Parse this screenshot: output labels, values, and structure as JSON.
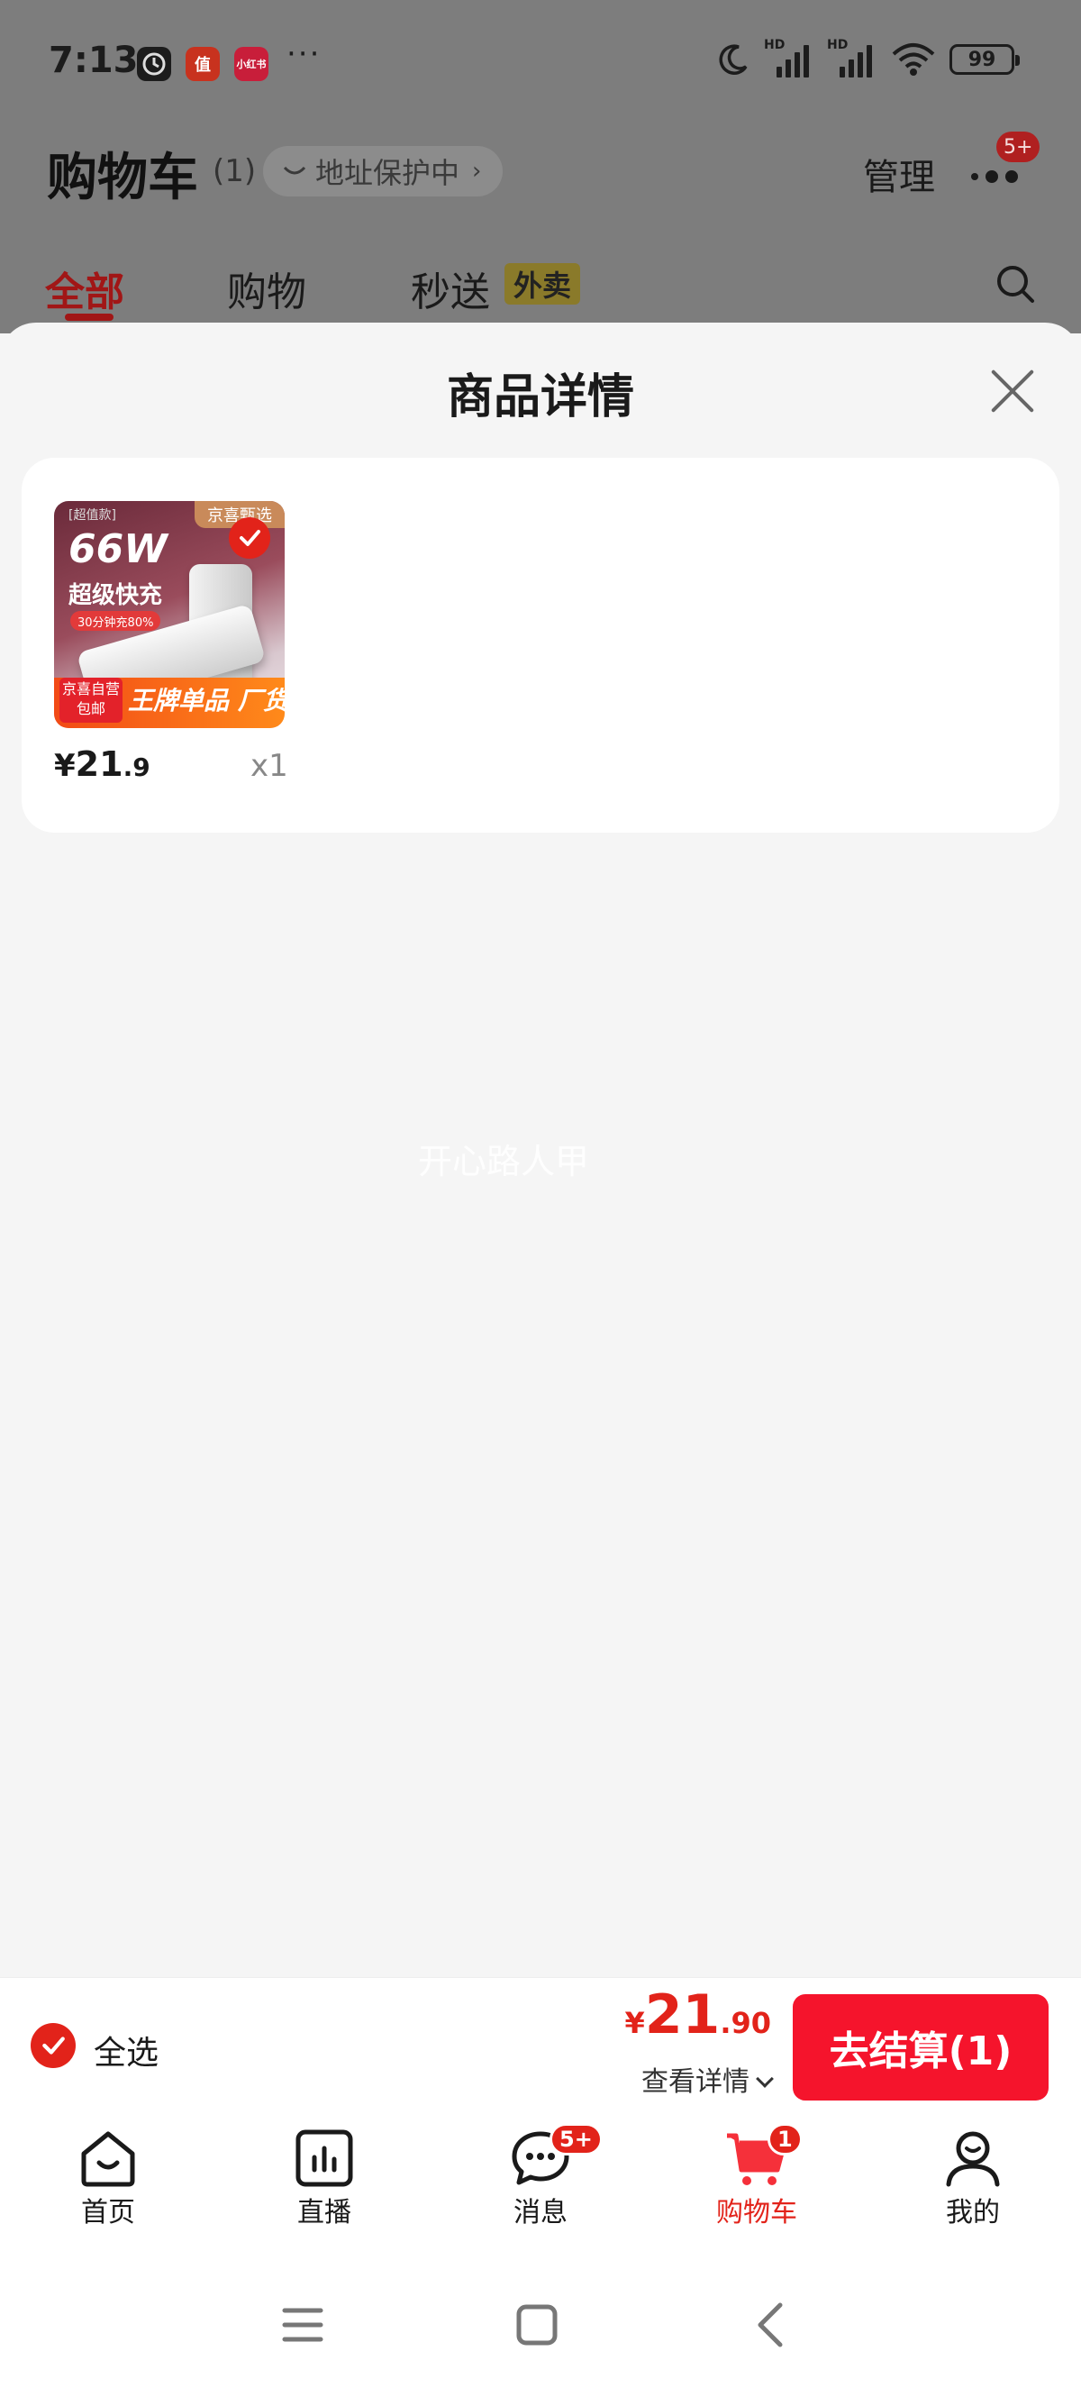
{
  "status_bar": {
    "time": "7:13",
    "apps": [
      {
        "name": "clock-app",
        "label": "",
        "color": "#1c1c1c"
      },
      {
        "name": "zhi-app",
        "label": "值",
        "color": "#c8321e"
      },
      {
        "name": "xiaohongshu-app",
        "label": "小红书",
        "color": "#e02040"
      }
    ],
    "more": "···",
    "hd1": "HD",
    "hd2": "HD",
    "battery": "99"
  },
  "header": {
    "title": "购物车",
    "count": "(1)",
    "address_protection": "地址保护中",
    "manage": "管理",
    "more_badge": "5+"
  },
  "tabs": [
    {
      "label": "全部",
      "active": true
    },
    {
      "label": "购物",
      "active": false
    },
    {
      "label": "秒送",
      "active": false,
      "tag": "外卖"
    }
  ],
  "sheet": {
    "title": "商品详情",
    "product": {
      "thumb_top_tag": "[超值款]",
      "thumb_brand": "京喜甄选",
      "thumb_watt": "66W",
      "thumb_fast": "超级快充",
      "thumb_charge": "30分钟充80%",
      "thumb_ship_1": "京喜自营",
      "thumb_ship_2": "包邮",
      "thumb_bottom": "王牌单品 厂货百补",
      "price_symbol": "¥",
      "price_int": "21",
      "price_dec": ".9",
      "quantity": "x1"
    },
    "watermark": "开心路人甲"
  },
  "checkout": {
    "select_all": "全选",
    "total_symbol": "¥",
    "total_int": "21",
    "total_dec": ".90",
    "detail_link": "查看详情",
    "checkout_button": "去结算(1)"
  },
  "tabbar": [
    {
      "label": "首页",
      "icon": "home-icon",
      "active": false
    },
    {
      "label": "直播",
      "icon": "live-icon",
      "active": false
    },
    {
      "label": "消息",
      "icon": "message-icon",
      "active": false,
      "badge": "5+"
    },
    {
      "label": "购物车",
      "icon": "cart-icon",
      "active": true,
      "badge": "1"
    },
    {
      "label": "我的",
      "icon": "profile-icon",
      "active": false
    }
  ],
  "colors": {
    "accent": "#e2231a",
    "checkout_button": "#f5142c",
    "dim_overlay": "#7d7d7d"
  }
}
